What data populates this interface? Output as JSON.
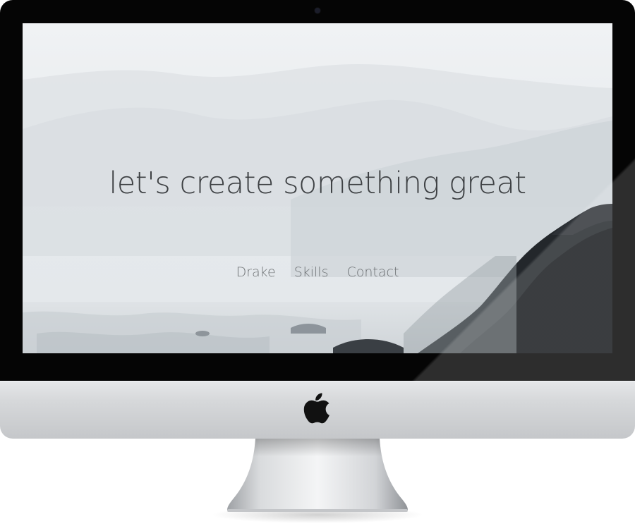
{
  "screen": {
    "hero_title": "let's create something great",
    "nav": [
      {
        "label": "Drake"
      },
      {
        "label": "Skills"
      },
      {
        "label": "Contact"
      }
    ]
  },
  "device": {
    "type": "imac",
    "logo": "apple-logo-icon",
    "camera": "camera-icon"
  },
  "colors": {
    "bezel": "#050505",
    "title_text": "#3d4043",
    "nav_text": "#6d7174",
    "chin": "#d6d8da"
  }
}
